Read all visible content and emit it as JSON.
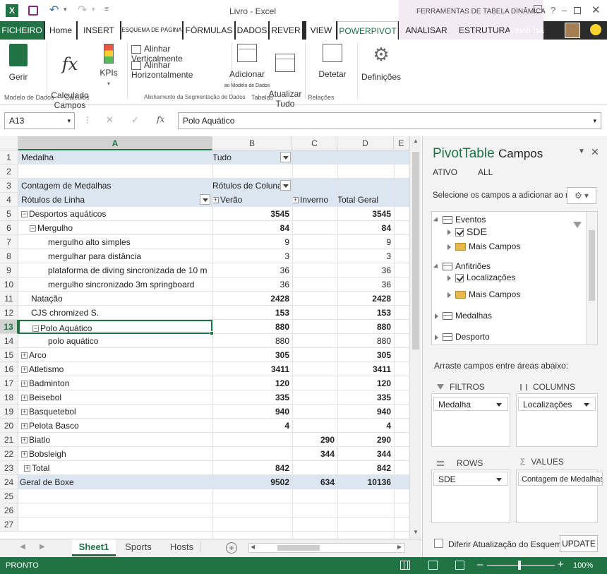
{
  "title": {
    "app": "Livro - Excel",
    "context_tools": "FERRAMENTAS DE TABELA DINÂMICA",
    "user": "David Isa"
  },
  "tabs": [
    "FICHEIRO",
    "Home",
    "INSERT",
    "ESQUEMA DE PÁGINA",
    "FÓRMULAS",
    "DADOS",
    "REVER",
    "VIEW",
    "POWERPIVOT",
    "ANALISAR",
    "ESTRUTURA"
  ],
  "ribbon": {
    "manage": "Gerir",
    "calc_fields": "Calculado\nCampos",
    "kpis": "KPIs",
    "align_v": "Alinhar Verticalmente",
    "align_h": "Alinhar Horizontalmente",
    "add_model": "Adicionar",
    "add_model_sub": "ao Modelo de Dados",
    "update_all": "Atualizar\nTudo",
    "detect": "Detetar",
    "settings": "Definições",
    "grp_model": "Modelo de Dados",
    "grp_calc": "Cálculos",
    "grp_slicer": "Alinhamento da Segmentação de Dados",
    "grp_tables": "Tabelas",
    "grp_rel": "Relações"
  },
  "formula": {
    "namebox": "A13",
    "value": "Polo Aquático"
  },
  "columns": [
    "A",
    "B",
    "C",
    "D",
    "E"
  ],
  "rows": [
    {
      "n": "1",
      "a": "Medalha",
      "b": "Tudo",
      "c": "",
      "d": ""
    },
    {
      "n": "2",
      "a": "",
      "b": "",
      "c": "",
      "d": ""
    },
    {
      "n": "3",
      "a": "Contagem de Medalhas",
      "b": "Rótulos de Coluna",
      "c": "",
      "d": ""
    },
    {
      "n": "4",
      "a": "Rótulos de Linha",
      "b": "Verão",
      "c": "Inverno",
      "d": "Total Geral"
    },
    {
      "n": "5",
      "a": "Desportos aquáticos",
      "b": "3545",
      "c": "",
      "d": "3545"
    },
    {
      "n": "6",
      "a": "Mergulho",
      "b": "84",
      "c": "",
      "d": "84"
    },
    {
      "n": "7",
      "a": "mergulho alto simples",
      "b": "9",
      "c": "",
      "d": "9"
    },
    {
      "n": "8",
      "a": "mergulhar para distância",
      "b": "3",
      "c": "",
      "d": "3"
    },
    {
      "n": "9",
      "a": "plataforma de diving sincronizada de 10 m",
      "b": "36",
      "c": "",
      "d": "36"
    },
    {
      "n": "10",
      "a": "mergulho sincronizado 3m springboard",
      "b": "36",
      "c": "",
      "d": "36"
    },
    {
      "n": "11",
      "a": "Natação",
      "b": "2428",
      "c": "",
      "d": "2428"
    },
    {
      "n": "12",
      "a": "CJS chromized S.",
      "b": "153",
      "c": "",
      "d": "153"
    },
    {
      "n": "13",
      "a": "Polo Aquático",
      "b": "880",
      "c": "",
      "d": "880"
    },
    {
      "n": "14",
      "a": "polo aquático",
      "b": "880",
      "c": "",
      "d": "880"
    },
    {
      "n": "15",
      "a": "Arco",
      "b": "305",
      "c": "",
      "d": "305"
    },
    {
      "n": "16",
      "a": "Atletismo",
      "b": "3411",
      "c": "",
      "d": "3411"
    },
    {
      "n": "17",
      "a": "Badminton",
      "b": "120",
      "c": "",
      "d": "120"
    },
    {
      "n": "18",
      "a": "Beisebol",
      "b": "335",
      "c": "",
      "d": "335"
    },
    {
      "n": "19",
      "a": "Basquetebol",
      "b": "940",
      "c": "",
      "d": "940"
    },
    {
      "n": "20",
      "a": "Pelota Basco",
      "b": "4",
      "c": "",
      "d": "4"
    },
    {
      "n": "21",
      "a": "Biatlo",
      "b": "",
      "c": "290",
      "d": "290"
    },
    {
      "n": "22",
      "a": "Bobsleigh",
      "b": "",
      "c": "344",
      "d": "344"
    },
    {
      "n": "23",
      "a": "Total",
      "b": "842",
      "c": "",
      "d": "842"
    },
    {
      "n": "24",
      "a": "Geral de Boxe",
      "b": "9502",
      "c": "634",
      "d": "10136"
    },
    {
      "n": "25",
      "a": "",
      "b": "",
      "c": "",
      "d": ""
    },
    {
      "n": "26",
      "a": "",
      "b": "",
      "c": "",
      "d": ""
    },
    {
      "n": "27",
      "a": "",
      "b": "",
      "c": "",
      "d": ""
    }
  ],
  "sheets": [
    "Sheet1",
    "Sports",
    "Hosts"
  ],
  "status": {
    "mode": "PRONTO",
    "zoom": "100%"
  },
  "pane": {
    "title1": "PivotTable",
    "title2": "Campos",
    "tab_active": "ATIVO",
    "tab_all": "ALL",
    "prompt": "Selecione os campos a adicionar ao relatório:",
    "fields": {
      "eventos": "Eventos",
      "sde": "SDE",
      "mais1": "Mais Campos",
      "anfitrioes": "Anfitriões",
      "localizacoes": "Localizações",
      "mais2": "Mais Campos",
      "medalhas": "Medalhas",
      "desporto": "Desporto"
    },
    "drag": "Arraste campos entre áreas abaixo:",
    "filters": "FILTROS",
    "columns": "COLUMNS",
    "rows": "ROWS",
    "values": "VALUES",
    "filter_val": "Medalha",
    "col_val": "Localizações",
    "row_val": "SDE",
    "value_val": "Contagem de Medalhas",
    "defer": "Diferir Atualização do Esquema",
    "update": "UPDATE"
  },
  "colors": {
    "excel_green": "#217346",
    "pivot_header": "#dce6f1"
  }
}
